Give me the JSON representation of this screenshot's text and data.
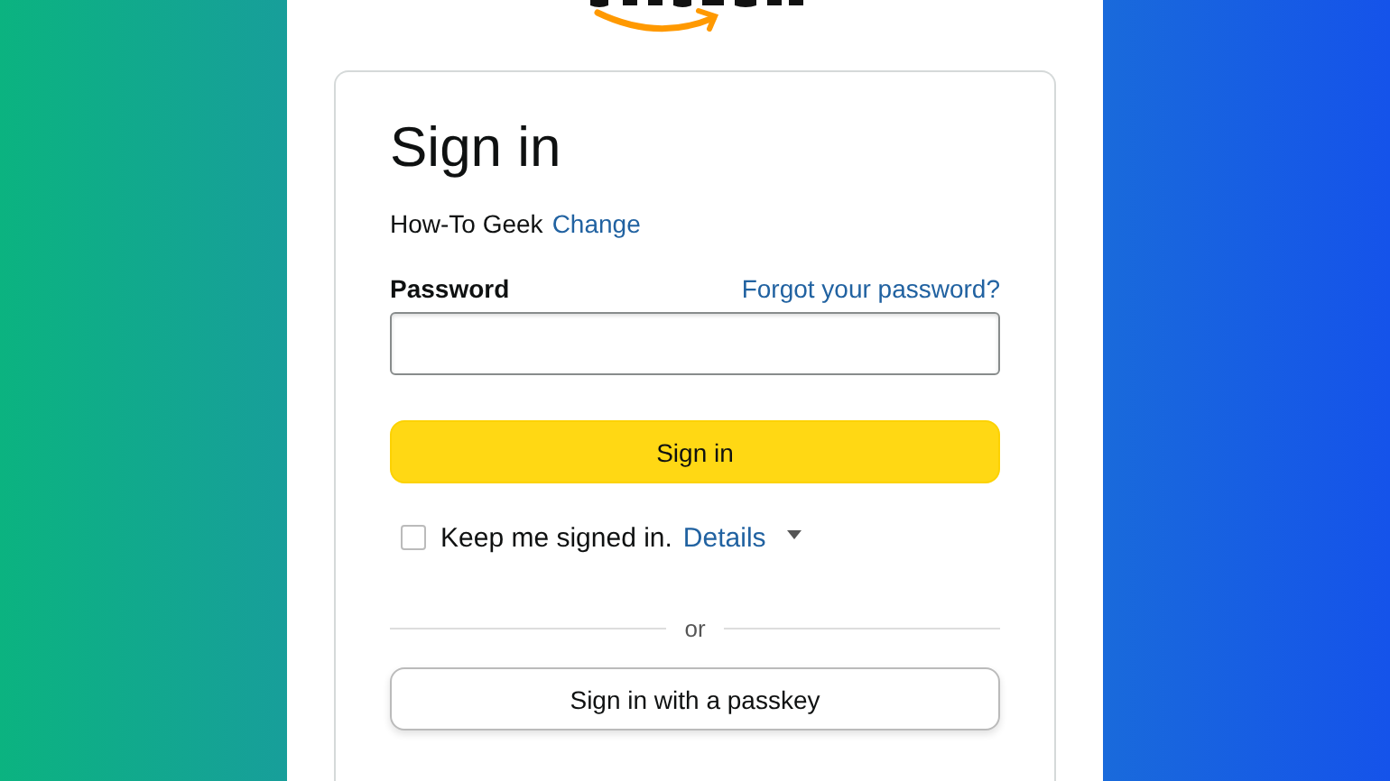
{
  "card": {
    "title": "Sign in",
    "account": {
      "name": "How-To Geek",
      "change_link": "Change"
    },
    "password": {
      "label": "Password",
      "forgot_link": "Forgot your password?"
    },
    "submit_button": "Sign in",
    "keep_signed_in": {
      "label": "Keep me signed in.",
      "checked": false,
      "details_link": "Details",
      "expanded": false
    },
    "divider_text": "or",
    "passkey_button": "Sign in with a passkey"
  }
}
